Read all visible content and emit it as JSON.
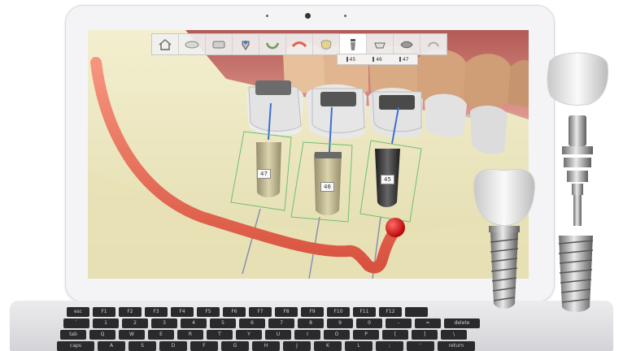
{
  "toolbar": {
    "items": [
      {
        "name": "home",
        "icon": "home-icon"
      },
      {
        "name": "scan",
        "icon": "scan-icon"
      },
      {
        "name": "arch",
        "icon": "arch-icon"
      },
      {
        "name": "tooth-setup",
        "icon": "tooth-setup-icon"
      },
      {
        "name": "gums",
        "icon": "gums-icon"
      },
      {
        "name": "nerve",
        "icon": "nerve-icon"
      },
      {
        "name": "crown",
        "icon": "crown-icon"
      },
      {
        "name": "implant",
        "icon": "implant-icon"
      },
      {
        "name": "abutment",
        "icon": "abutment-icon"
      },
      {
        "name": "guide",
        "icon": "guide-icon"
      },
      {
        "name": "export",
        "icon": "export-icon"
      }
    ]
  },
  "legend": {
    "items": [
      "45",
      "46",
      "47"
    ]
  },
  "implants": {
    "left": "47",
    "middle": "46",
    "right": "45"
  },
  "keyboard": {
    "row1": [
      "esc",
      "F1",
      "F2",
      "F3",
      "F4",
      "F5",
      "F6",
      "F7",
      "F8",
      "F9",
      "F10",
      "F11",
      "F12",
      ""
    ],
    "row2": [
      "`",
      "1",
      "2",
      "3",
      "4",
      "5",
      "6",
      "7",
      "8",
      "9",
      "0",
      "-",
      "=",
      "delete"
    ],
    "row3": [
      "tab",
      "Q",
      "W",
      "E",
      "R",
      "T",
      "Y",
      "U",
      "I",
      "O",
      "P",
      "[",
      "]",
      "\\"
    ],
    "row4": [
      "caps",
      "A",
      "S",
      "D",
      "F",
      "G",
      "H",
      "J",
      "K",
      "L",
      ";",
      "'",
      "return"
    ]
  },
  "colors": {
    "nerve": "#f07058",
    "bone": "#f0ecc8",
    "gum": "#d98c84",
    "guide": "#6fbf6f"
  }
}
